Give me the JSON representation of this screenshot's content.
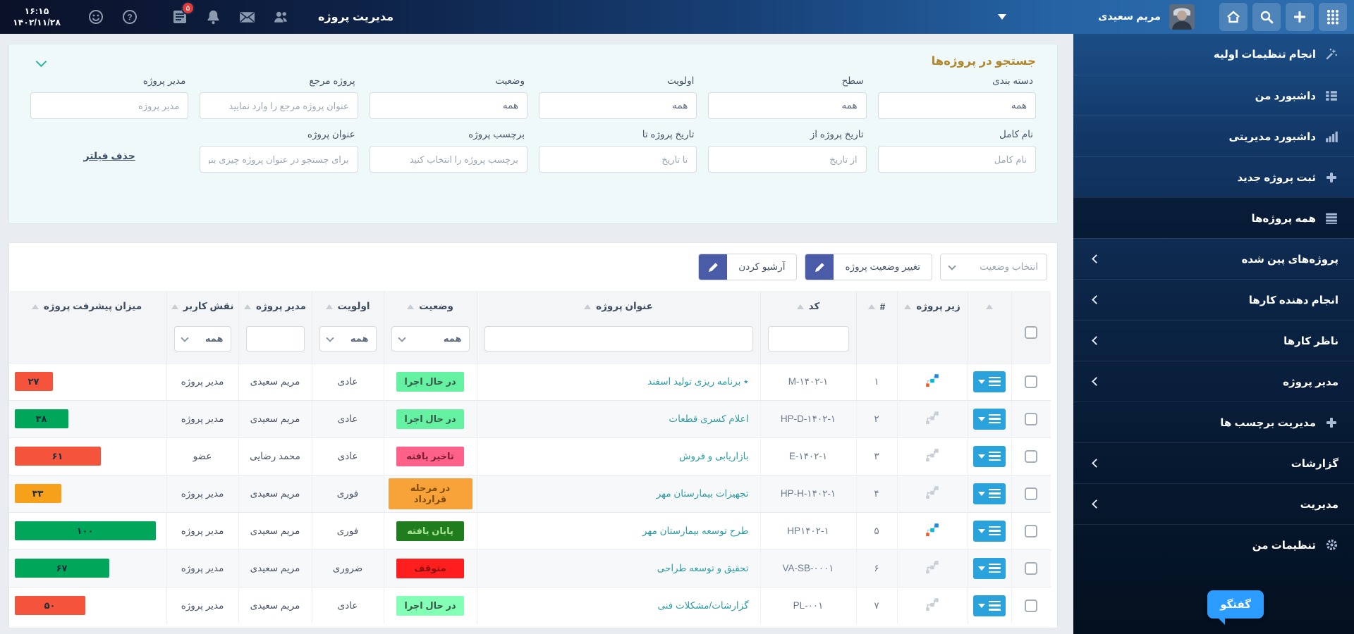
{
  "topbar": {
    "time": "۱۶:۱۵",
    "date": "۱۴۰۲/۱۱/۲۸",
    "notification_badge": "۵",
    "app_title": "مدیریت پروژه",
    "user_name": "مریم سعیدی"
  },
  "sidebar": {
    "items": [
      {
        "label": "انجام تنظیمات اولیه",
        "icon": "magic-wand-icon"
      },
      {
        "label": "داشبورد من",
        "icon": "dashboard-icon"
      },
      {
        "label": "داشبورد مدیریتی",
        "icon": "bar-chart-icon"
      },
      {
        "label": "ثبت پروژه جدید",
        "icon": "plus-icon"
      },
      {
        "label": "همه پروژه‌ها",
        "icon": "list-icon",
        "active": true
      },
      {
        "label": "پروژه‌های پین شده",
        "expandable": true
      },
      {
        "label": "انجام دهنده کارها",
        "expandable": true
      },
      {
        "label": "ناظر کارها",
        "expandable": true
      },
      {
        "label": "مدیر پروژه",
        "expandable": true
      },
      {
        "label": "مدیریت برچسب ها",
        "icon": "plus-icon"
      },
      {
        "label": "گزارشات",
        "expandable": true
      },
      {
        "label": "مدیریت",
        "expandable": true
      },
      {
        "label": "تنظیمات من",
        "icon": "gear-icon"
      }
    ],
    "chat_button": "گفتگو"
  },
  "search_panel": {
    "title": "جستجو در پروژه‌ها",
    "clear_filter": "حذف فیلتر",
    "row1": [
      {
        "label": "دسته بندی",
        "type": "select",
        "value": "همه"
      },
      {
        "label": "سطح",
        "type": "select",
        "value": "همه"
      },
      {
        "label": "اولویت",
        "type": "select",
        "value": "همه"
      },
      {
        "label": "وضعیت",
        "type": "select",
        "value": "همه"
      },
      {
        "label": "پروژه مرجع",
        "type": "text",
        "placeholder": "عنوان پروژه مرجع را وارد نمایید"
      },
      {
        "label": "مدیر پروژه",
        "type": "text",
        "placeholder": "مدیر پروژه"
      }
    ],
    "row2": [
      {
        "label": "نام کامل",
        "type": "text",
        "placeholder": "نام کامل"
      },
      {
        "label": "تاریخ پروژه از",
        "type": "text",
        "placeholder": "از تاریخ"
      },
      {
        "label": "تاریخ پروژه تا",
        "type": "text",
        "placeholder": "تا تاریخ"
      },
      {
        "label": "برچسب پروژه",
        "type": "text",
        "placeholder": "برچسب پروژه را انتخاب کنید"
      },
      {
        "label": "عنوان پروژه",
        "type": "text",
        "placeholder": "برای جستجو در عنوان پروژه چیزی بنویسید"
      },
      {
        "label": "",
        "type": "link"
      }
    ]
  },
  "toolbar": {
    "status_select": "انتخاب وضعیت",
    "change_status_button": "تغییر وضعیت پروژه",
    "archive_button": "آرشیو کردن"
  },
  "table": {
    "columns": [
      {
        "key": "checkbox",
        "label": "",
        "filter": "checkbox",
        "sort": false
      },
      {
        "key": "actions",
        "label": "",
        "filter": "none",
        "sort": true
      },
      {
        "key": "sub",
        "label": "زیر پروژه",
        "filter": "none",
        "sort": true
      },
      {
        "key": "num",
        "label": "#",
        "filter": "none",
        "sort": true
      },
      {
        "key": "code",
        "label": "کد",
        "filter": "input",
        "sort": true
      },
      {
        "key": "title",
        "label": "عنوان پروژه",
        "filter": "input",
        "sort": true
      },
      {
        "key": "status",
        "label": "وضعیت",
        "filter": "select",
        "value": "همه",
        "sort": true
      },
      {
        "key": "priority",
        "label": "اولویت",
        "filter": "select",
        "value": "همه",
        "sort": true
      },
      {
        "key": "manager",
        "label": "مدیر پروژه",
        "filter": "input",
        "sort": true
      },
      {
        "key": "role",
        "label": "نقش کاربر",
        "filter": "select",
        "value": "همه",
        "sort": true
      },
      {
        "key": "progress",
        "label": "میزان پیشرفت پروژه",
        "filter": "none",
        "sort": true
      }
    ],
    "rows": [
      {
        "num": "۱",
        "code": "M-۱۴۰۲-۱",
        "title": "٭ برنامه ریزی تولید اسفند",
        "status": {
          "label": "در حال اجرا",
          "bg": "#64F2A2",
          "fg": "#3A5A49"
        },
        "priority": "عادی",
        "manager": "مریم سعیدی",
        "role": "مدیر پروژه",
        "progress": {
          "value": "۲۷",
          "pct": 27,
          "color": "#F4543C"
        },
        "sub_colored": true
      },
      {
        "num": "۲",
        "code": "HP-D-۱۴۰۲-۱",
        "title": "اعلام کسری قطعات",
        "status": {
          "label": "در حال اجرا",
          "bg": "#64F2A2",
          "fg": "#3A5A49"
        },
        "priority": "عادی",
        "manager": "مریم سعیدی",
        "role": "مدیر پروژه",
        "progress": {
          "value": "۳۸",
          "pct": 38,
          "color": "#00A65A"
        },
        "sub_colored": false
      },
      {
        "num": "۳",
        "code": "E-۱۴۰۲-۱",
        "title": "بازاریابی و فروش",
        "status": {
          "label": "تاخیر یافته",
          "bg": "#FF6189",
          "fg": "#7C2030"
        },
        "priority": "عادی",
        "manager": "محمد رضایی",
        "role": "عضو",
        "progress": {
          "value": "۶۱",
          "pct": 61,
          "color": "#F4543C"
        },
        "sub_colored": false
      },
      {
        "num": "۴",
        "code": "HP-H-۱۴۰۲-۱",
        "title": "تجهیزات بیمارستان مهر",
        "status": {
          "label": "در مرحله قرارداد",
          "bg": "#F8A33A",
          "fg": "#7C4A00"
        },
        "priority": "فوری",
        "manager": "مریم سعیدی",
        "role": "مدیر پروژه",
        "progress": {
          "value": "۳۳",
          "pct": 33,
          "color": "#F7A11B"
        },
        "sub_colored": false
      },
      {
        "num": "۵",
        "code": "HP۱۴۰۲-۱",
        "title": "طرح توسعه بیمارستان مهر",
        "status": {
          "label": "پایان یافته",
          "bg": "#1F7D1E",
          "fg": "#A8E593"
        },
        "priority": "فوری",
        "manager": "مریم سعیدی",
        "role": "مدیر پروژه",
        "progress": {
          "value": "۱۰۰",
          "pct": 100,
          "color": "#00A65A"
        },
        "sub_colored": true
      },
      {
        "num": "۶",
        "code": "VA-SB-۰۰۰۱",
        "title": "تحقیق و توسعه طراحی",
        "status": {
          "label": "متوقف",
          "bg": "#FF1E1E",
          "fg": "#8C0F0F"
        },
        "priority": "ضروری",
        "manager": "مریم سعیدی",
        "role": "مدیر پروژه",
        "progress": {
          "value": "۶۷",
          "pct": 67,
          "color": "#00A65A"
        },
        "sub_colored": false
      },
      {
        "num": "۷",
        "code": "PL-۰۰۱",
        "title": "گزارشات/مشکلات فنی",
        "status": {
          "label": "در حال اجرا",
          "bg": "#83FFB6",
          "fg": "#3A5A49"
        },
        "priority": "عادی",
        "manager": "مریم سعیدی",
        "role": "مدیر پروژه",
        "progress": {
          "value": "۵۰",
          "pct": 50,
          "color": "#F4543C"
        },
        "sub_colored": false
      }
    ]
  }
}
